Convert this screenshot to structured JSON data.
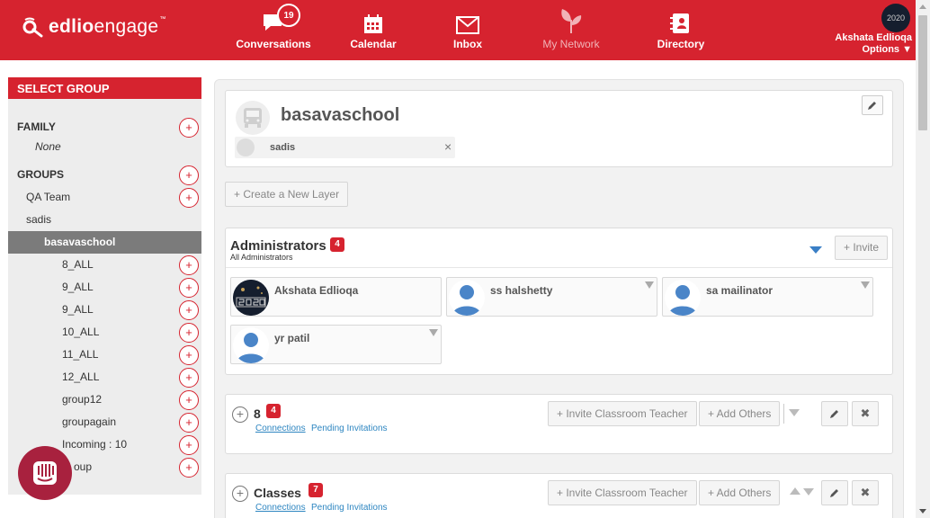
{
  "brand": {
    "name_bold": "edlio",
    "name_rest": "engage",
    "tm": "™"
  },
  "nav": {
    "conversations": {
      "label": "Conversations",
      "badge": "19"
    },
    "calendar": {
      "label": "Calendar"
    },
    "inbox": {
      "label": "Inbox"
    },
    "my_network": {
      "label": "My Network"
    },
    "directory": {
      "label": "Directory"
    }
  },
  "user": {
    "name": "Akshata Edlioqa",
    "options_label": "Options ▼",
    "avatar_text": "2020"
  },
  "sidebar": {
    "title": "SELECT GROUP",
    "family_label": "FAMILY",
    "family_value": "None",
    "groups_label": "GROUPS",
    "groups": [
      {
        "label": "QA Team"
      },
      {
        "label": "sadis"
      },
      {
        "label": "basavaschool"
      },
      {
        "label": "8_ALL"
      },
      {
        "label": "9_ALL"
      },
      {
        "label": "9_ALL"
      },
      {
        "label": "10_ALL"
      },
      {
        "label": "11_ALL"
      },
      {
        "label": "12_ALL"
      },
      {
        "label": "group12"
      },
      {
        "label": "groupagain"
      },
      {
        "label": "Incoming : 10"
      },
      {
        "label": "oup"
      }
    ],
    "plus_glyph": "+"
  },
  "school": {
    "name": "basavaschool",
    "chip_label": "sadis",
    "chip_close": "×"
  },
  "create_layer_label": "+ Create a New Layer",
  "administrators": {
    "title": "Administrators",
    "count": "4",
    "subtitle": "All Administrators",
    "invite_label": "+ Invite",
    "members": [
      {
        "name": "Akshata Edlioqa"
      },
      {
        "name": "ss halshetty"
      },
      {
        "name": "sa mailinator"
      },
      {
        "name": "yr patil"
      }
    ]
  },
  "layers": [
    {
      "title": "8",
      "count": "4",
      "invite_teacher_label": "+ Invite Classroom Teacher",
      "add_others_label": "+ Add Others",
      "connections_label": "Connections",
      "pending_label": "Pending Invitations"
    },
    {
      "title": "Classes",
      "count": "7",
      "invite_teacher_label": "+ Invite Classroom Teacher",
      "add_others_label": "+ Add Others",
      "connections_label": "Connections",
      "pending_label": "Pending Invitations"
    }
  ],
  "glyphs": {
    "plus": "+",
    "close": "✖"
  },
  "colors": {
    "brand_red": "#d6232f",
    "link_blue": "#2e86c1",
    "chat_purple": "#a8213e"
  }
}
